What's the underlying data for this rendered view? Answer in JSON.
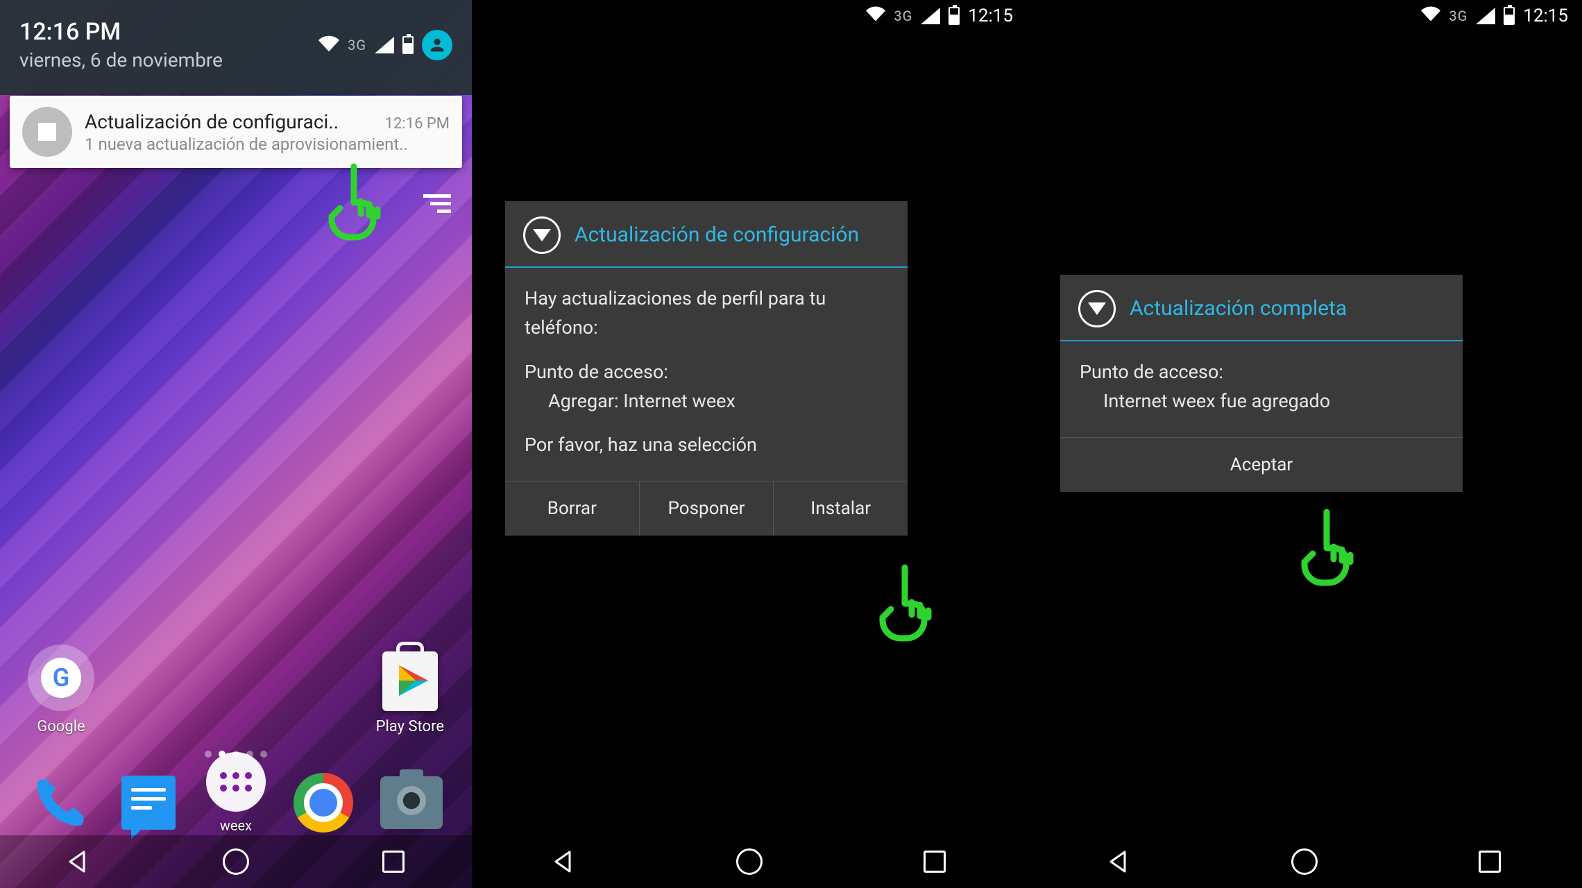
{
  "phone1": {
    "shade": {
      "time": "12:16 PM",
      "date": "viernes, 6 de noviembre",
      "network": "3G"
    },
    "notification": {
      "title": "Actualización de configuraci..",
      "timestamp": "12:16 PM",
      "subtitle": "1 nueva actualización de aprovisionamient.."
    },
    "home": {
      "folder_google": "Google",
      "play_store": "Play Store",
      "dock_apps": "weex"
    }
  },
  "phone2": {
    "status": {
      "network": "3G",
      "time": "12:15"
    },
    "dialog": {
      "title": "Actualización de configuración",
      "line1": "Hay actualizaciones de perfil para tu teléfono:",
      "ap_label": "Punto de acceso:",
      "ap_action": "Agregar: Internet weex",
      "prompt": "Por favor, haz una selección",
      "buttons": {
        "delete": "Borrar",
        "postpone": "Posponer",
        "install": "Instalar"
      }
    }
  },
  "phone3": {
    "status": {
      "network": "3G",
      "time": "12:15"
    },
    "dialog": {
      "title": "Actualización completa",
      "ap_label": "Punto de acceso:",
      "ap_result": "Internet weex fue agregado",
      "buttons": {
        "accept": "Aceptar"
      }
    }
  }
}
